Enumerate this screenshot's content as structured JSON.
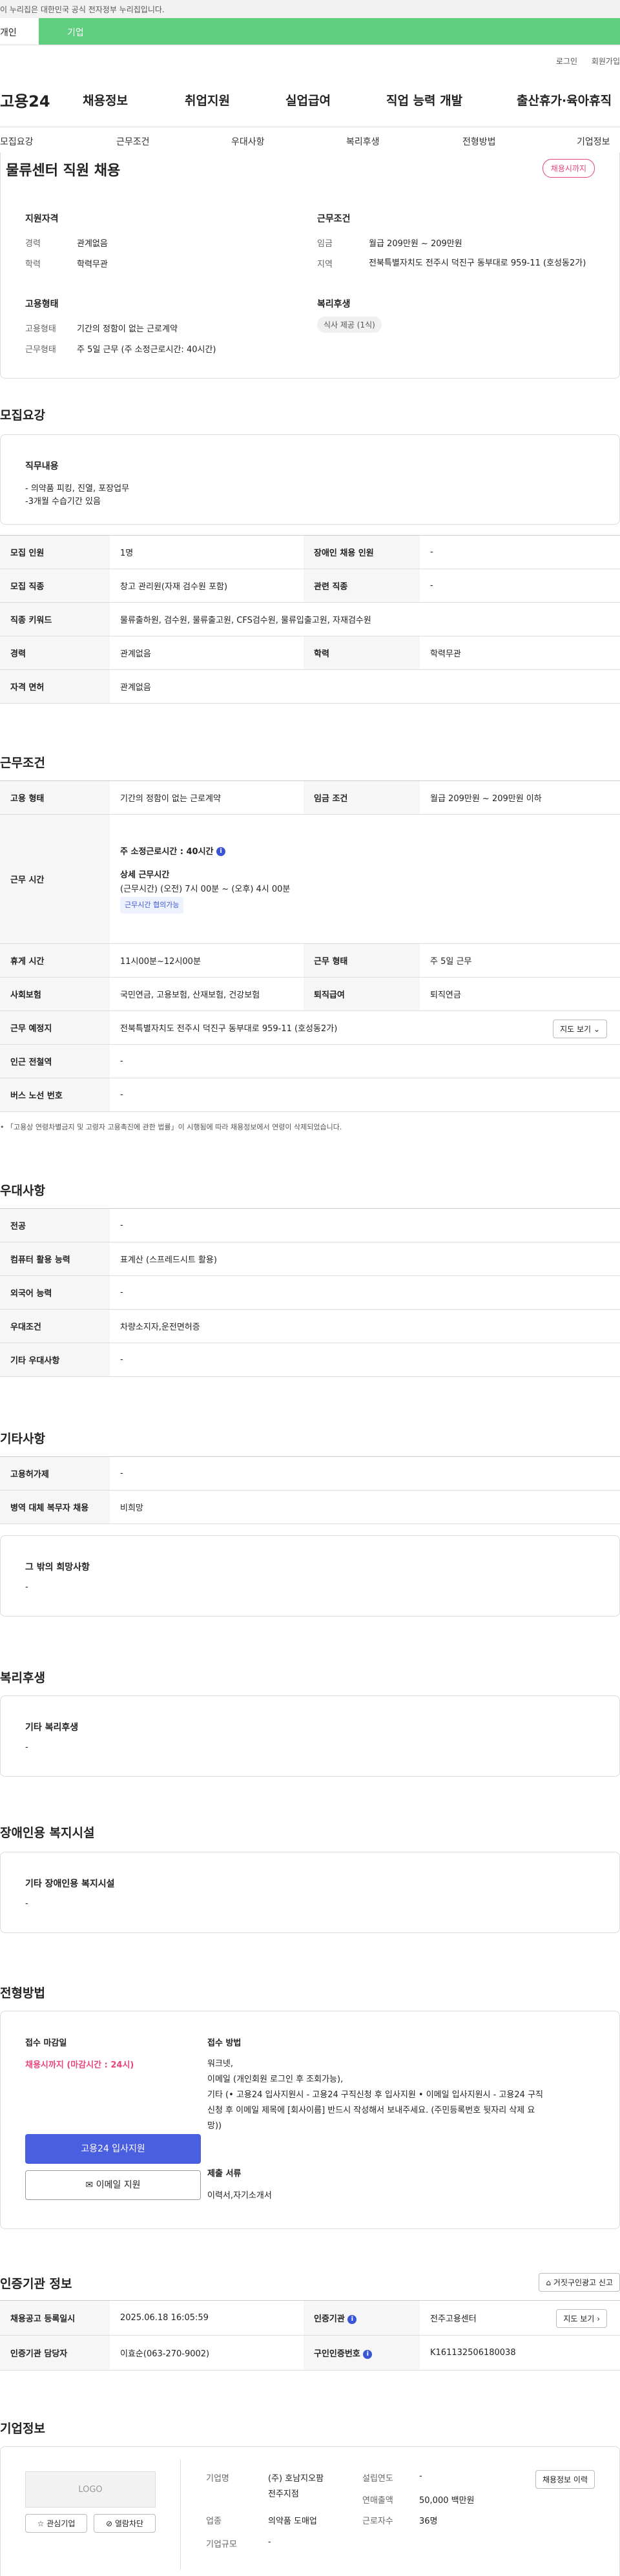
{
  "gov_banner": "이 누리집은 대한민국 공식 전자정부 누리집입니다.",
  "top_tabs": [
    "개인",
    "기업"
  ],
  "util_links": [
    "로그인",
    "회원가입"
  ],
  "logo": "고용24",
  "gnb": [
    "채용정보",
    "취업지원",
    "실업급여",
    "직업 능력 개발",
    "출산휴가·육아휴직"
  ],
  "anchor_tabs": [
    "모집요강",
    "근무조건",
    "우대사항",
    "복리후생",
    "전형방법",
    "기업정보"
  ],
  "job": {
    "title": "물류센터 직원 채용",
    "deadline_badge": "채용시까지",
    "qual_title": "지원자격",
    "career_label": "경력",
    "career_value": "관계없음",
    "edu_label": "학력",
    "edu_value": "학력무관",
    "cond_title": "근무조건",
    "wage_label": "임금",
    "wage_value": "월급 209만원 ~ 209만원",
    "region_label": "지역",
    "region_value": "전북특별자치도 전주시 덕진구 동부대로 959-11 (호성동2가)",
    "emp_title": "고용형태",
    "emp_label": "고용형태",
    "emp_value": "기간의 정함이 없는 근로계약",
    "worktype_label": "근무형태",
    "worktype_value": "주 5일 근무 (주 소정근로시간: 40시간)",
    "welfare_title": "복리후생",
    "welfare_chip": "식사 제공 (1식)"
  },
  "recruit": {
    "title": "모집요강",
    "duty_title": "직무내용",
    "duty_lines": [
      "- 의약품 피킹, 진열, 포장업무",
      "-3개월 수습기간 있음"
    ],
    "rows": [
      [
        "모집 인원",
        "1명",
        "장애인 채용 인원",
        "-"
      ],
      [
        "모집 직종",
        "창고 관리원(자재 검수원 포함)",
        "관련 직종",
        "-"
      ],
      [
        "직종 키워드",
        "물류출하원, 검수원, 물류출고원, CFS검수원, 물류입출고원, 자재검수원",
        "",
        ""
      ],
      [
        "경력",
        "관계없음",
        "학력",
        "학력무관"
      ],
      [
        "자격 면허",
        "관계없음",
        "",
        ""
      ]
    ]
  },
  "work": {
    "title": "근무조건",
    "emp_type_label": "고용 형태",
    "emp_type_value": "기간의 정함이 없는 근로계약",
    "wage_label": "임금 조건",
    "wage_value": "월급 209만원 ~ 209만원 이하",
    "hours_label": "근무 시간",
    "hours_main": "주 소정근로시간 : 40시간",
    "hours_detail_title": "상세 근무시간",
    "hours_detail": "(근무시간) (오전) 7시 00분 ~ (오후) 4시 00분",
    "hours_badge": "근무시간 협의가능",
    "break_label": "휴게 시간",
    "break_value": "11시00분~12시00분",
    "type_label": "근무 형태",
    "type_value": "주 5일 근무",
    "insurance_label": "사회보험",
    "insurance_value": "국민연금, 고용보험, 산재보험, 건강보험",
    "retire_label": "퇴직급여",
    "retire_value": "퇴직연금",
    "place_label": "근무 예정지",
    "place_value": "전북특별자치도 전주시 덕진구 동부대로 959-11 (호성동2가)",
    "map_btn": "지도 보기",
    "subway_label": "인근 전철역",
    "subway_value": "-",
    "bus_label": "버스 노선 번호",
    "bus_value": "-",
    "note": "「고용상 연령차별금지 및 고령자 고용촉진에 관한 법률」이 시행됨에 따라 채용정보에서 연령이 삭제되었습니다."
  },
  "pref": {
    "title": "우대사항",
    "rows": [
      [
        "전공",
        "-"
      ],
      [
        "컴퓨터 활용 능력",
        "표계산 (스프레드시트 활용)"
      ],
      [
        "외국어 능력",
        "-"
      ],
      [
        "우대조건",
        "차량소지자,운전면허증"
      ],
      [
        "기타 우대사항",
        "-"
      ]
    ]
  },
  "etc": {
    "title": "기타사항",
    "rows": [
      [
        "고용허가제",
        "-"
      ],
      [
        "병역 대체 복무자 채용",
        "비희망"
      ]
    ],
    "hope_title": "그 밖의 희망사항",
    "hope_value": "-"
  },
  "welfare": {
    "title": "복리후생",
    "sub": "기타 복리후생",
    "value": "-"
  },
  "disabled": {
    "title": "장애인용 복지시설",
    "sub": "기타 장애인용 복지시설",
    "value": "-"
  },
  "select": {
    "title": "전형방법",
    "deadline_title": "접수 마감일",
    "deadline_value": "채용시까지 (마감시간 : 24시)",
    "method_title": "접수 방법",
    "method_lines": [
      "워크넷,",
      "이메일 (개인회원 로그인 후 조회가능),",
      "기타 (• 고용24 입사지원시 - 고용24 구직신청 후 입사지원 • 이메일 입사지원시 - 고용24 구직",
      "신청 후 이메일 제목에 [회사이름] 반드시 작성해서 보내주세요. (주민등록번호 뒷자리 삭제 요",
      "망))"
    ],
    "docs_title": "제출 서류",
    "docs_value": "이력서,자기소개서",
    "apply_btn": "고용24 입사지원",
    "email_btn": "이메일 지원"
  },
  "agency": {
    "title": "인증기관 정보",
    "report_btn": "거짓구인광고 신고",
    "reg_label": "채용공고 등록일시",
    "reg_value": "2025.06.18 16:05:59",
    "org_label": "인증기관",
    "org_value": "전주고용센터",
    "map_btn": "지도 보기",
    "mgr_label": "인증기관 담당자",
    "mgr_value": "이효순(063-270-9002)",
    "num_label": "구인인증번호",
    "num_value": "K161132506180038"
  },
  "company": {
    "title": "기업정보",
    "logo_text": "LOGO",
    "fav_btn": "관심기업",
    "block_btn": "열람차단",
    "name_label": "기업명",
    "name_value1": "(주) 호남지오팜",
    "name_value2": "전주지점",
    "year_label": "설립연도",
    "year_value": "-",
    "sales_label": "연매출액",
    "sales_value": "50,000 백만원",
    "biz_label": "업종",
    "biz_value": "의약품 도매업",
    "emp_label": "근로자수",
    "emp_value": "36명",
    "size_label": "기업규모",
    "size_value": "-",
    "history_btn": "채용정보 이력"
  }
}
